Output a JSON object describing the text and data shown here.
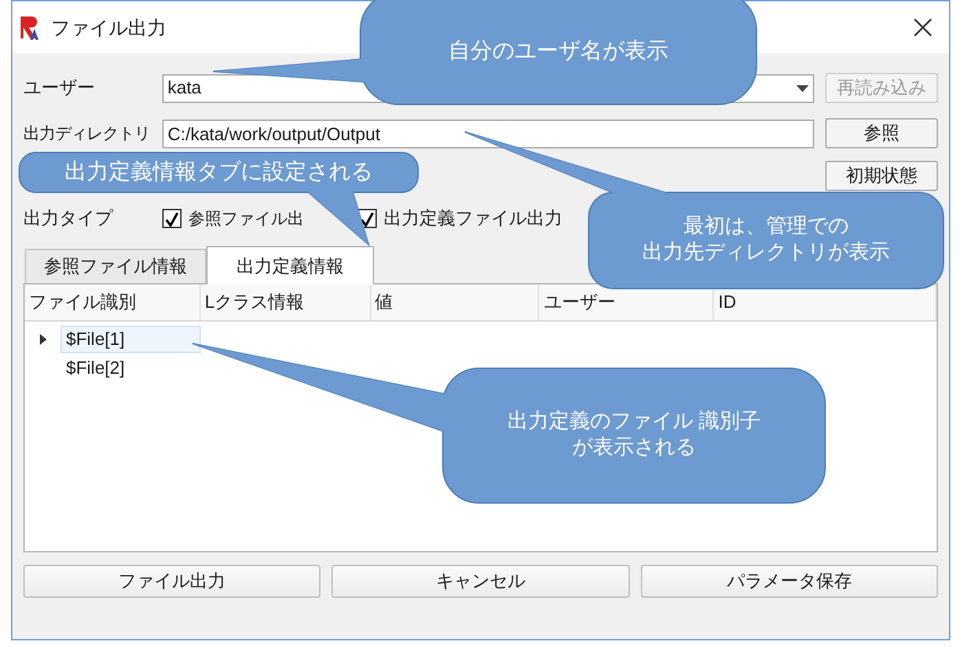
{
  "window": {
    "title": "ファイル出力"
  },
  "form": {
    "user_label": "ユーザー",
    "user_value": "kata",
    "reload_button": {
      "label": "再読み込み",
      "disabled": true
    },
    "dir_label": "出力ディレクトリ",
    "dir_value": "C:/kata/work/output/Output",
    "browse_button": "参照",
    "reset_button": "初期状態",
    "type_label": "出力タイプ",
    "checkboxes": [
      {
        "label": "参照ファイル出",
        "checked": true
      },
      {
        "label": "出力定義ファイル出力",
        "checked": true
      }
    ]
  },
  "tabs": [
    {
      "label": "参照ファイル情報",
      "selected": false
    },
    {
      "label": "出力定義情報",
      "selected": true
    }
  ],
  "table": {
    "columns": [
      "ファイル識別",
      "Lクラス情報",
      "値",
      "ユーザー",
      "ID"
    ],
    "rows": [
      {
        "cells": [
          "$File[1]"
        ],
        "expandable": true,
        "selected": true
      },
      {
        "cells": [
          "$File[2]"
        ],
        "expandable": false,
        "selected": false
      }
    ]
  },
  "buttons": [
    "ファイル出力",
    "キャンセル",
    "パラメータ保存"
  ],
  "callouts": [
    {
      "lines": [
        "自分のユーザ名が表示"
      ]
    },
    {
      "lines": [
        "出力定義情報タブに設定される"
      ]
    },
    {
      "lines": [
        "最初は、管理での",
        "出力先ディレクトリが表示"
      ]
    },
    {
      "lines": [
        "出力定義のファイル 識別子",
        "が表示される"
      ]
    }
  ]
}
